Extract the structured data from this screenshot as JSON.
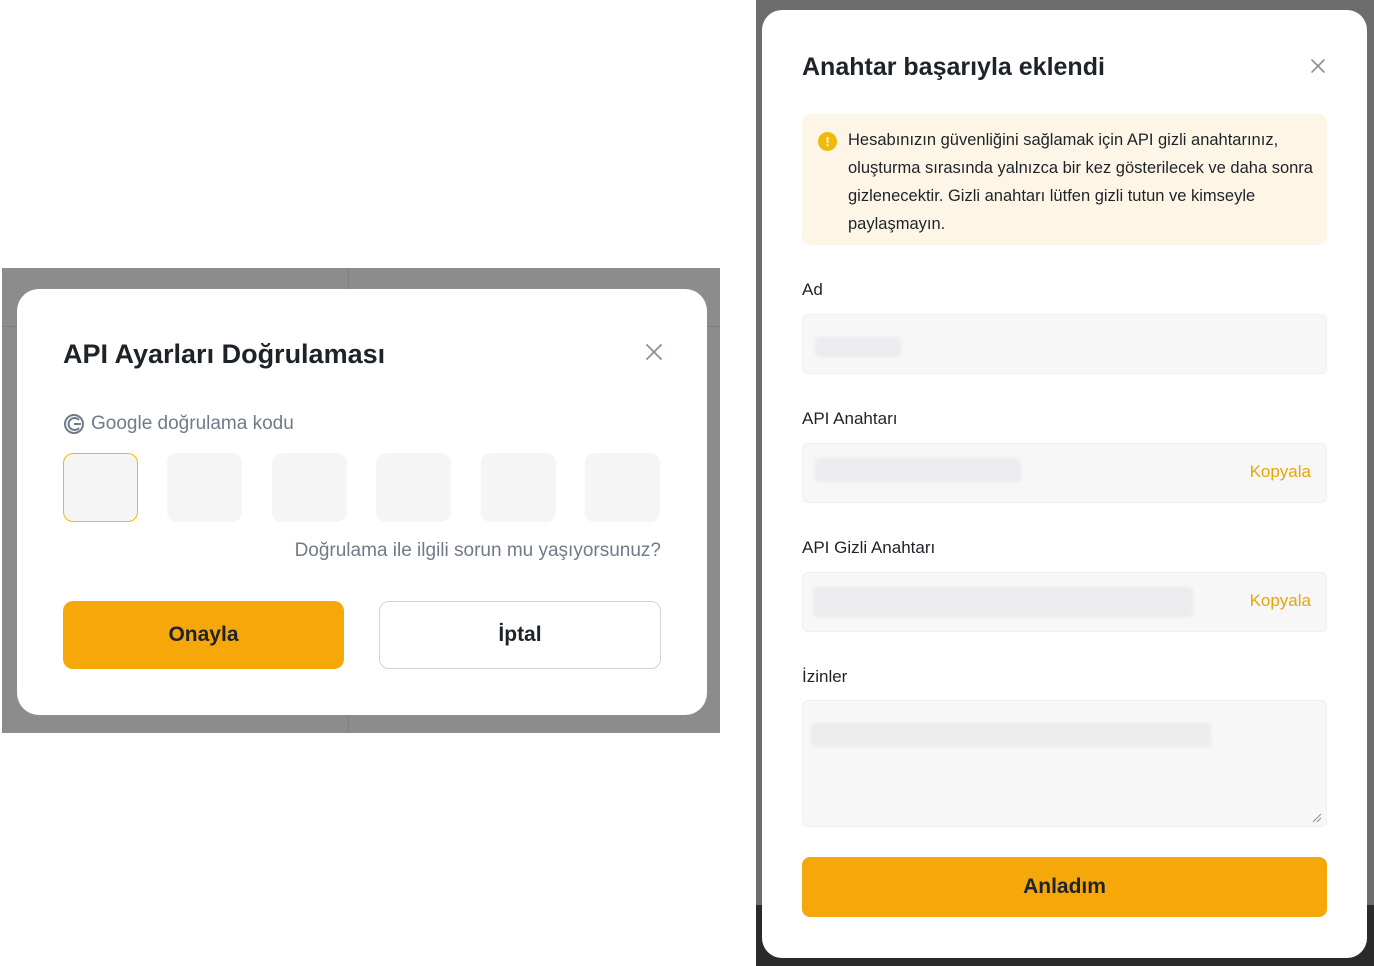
{
  "verify_dialog": {
    "title": "API Ayarları Doğrulaması",
    "google_label": "Google doğrulama kodu",
    "code_box_count": 6,
    "help_link": "Doğrulama ile ilgili sorun mu yaşıyorsunuz?",
    "confirm_label": "Onayla",
    "cancel_label": "İptal",
    "icons": {
      "close": "close-icon",
      "google": "google-icon"
    }
  },
  "key_dialog": {
    "title": "Anahtar başarıyla eklendi",
    "warning": "Hesabınızın güvenliğini sağlamak için API gizli anahtarınız, oluşturma sırasında yalnızca bir kez gösterilecek ve daha sonra gizlenecektir. Gizli anahtarı lütfen gizli tutun ve kimseyle paylaşmayın.",
    "fields": {
      "name_label": "Ad",
      "api_key_label": "API Anahtarı",
      "api_secret_label": "API Gizli Anahtarı",
      "permissions_label": "İzinler"
    },
    "copy_label": "Kopyala",
    "ok_label": "Anladım",
    "icons": {
      "close": "close-icon",
      "warning": "warning-icon"
    }
  },
  "colors": {
    "accent": "#f6a70a",
    "link": "#e8a50a",
    "warning_bg": "#fdf6e6",
    "active_border": "#f0b90b"
  }
}
